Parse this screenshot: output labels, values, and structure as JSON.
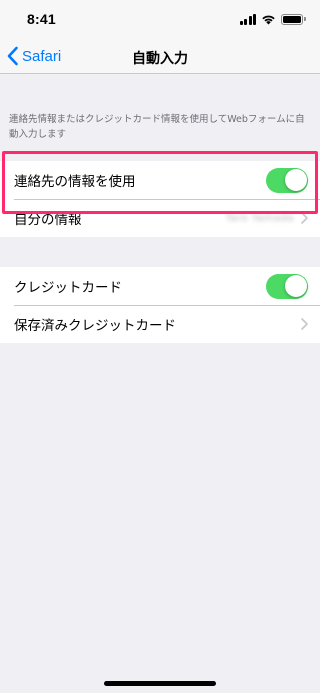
{
  "status_bar": {
    "time": "8:41",
    "icons": [
      "cellular-signal-icon",
      "wifi-icon",
      "battery-icon"
    ]
  },
  "nav": {
    "back_label": "Safari",
    "title": "自動入力"
  },
  "description": "連絡先情報またはクレジットカード情報を使用してWebフォームに自動入力します",
  "group1": {
    "use_contact_label": "連絡先の情報を使用",
    "use_contact_on": true,
    "my_info_label": "自分の情報",
    "my_info_value": "Taro Yamada"
  },
  "group2": {
    "credit_card_label": "クレジットカード",
    "credit_card_on": true,
    "saved_cards_label": "保存済みクレジットカード"
  },
  "colors": {
    "accent": "#007aff",
    "toggle_on": "#4cd964",
    "highlight": "#ff2a6d",
    "background": "#efeff4"
  }
}
